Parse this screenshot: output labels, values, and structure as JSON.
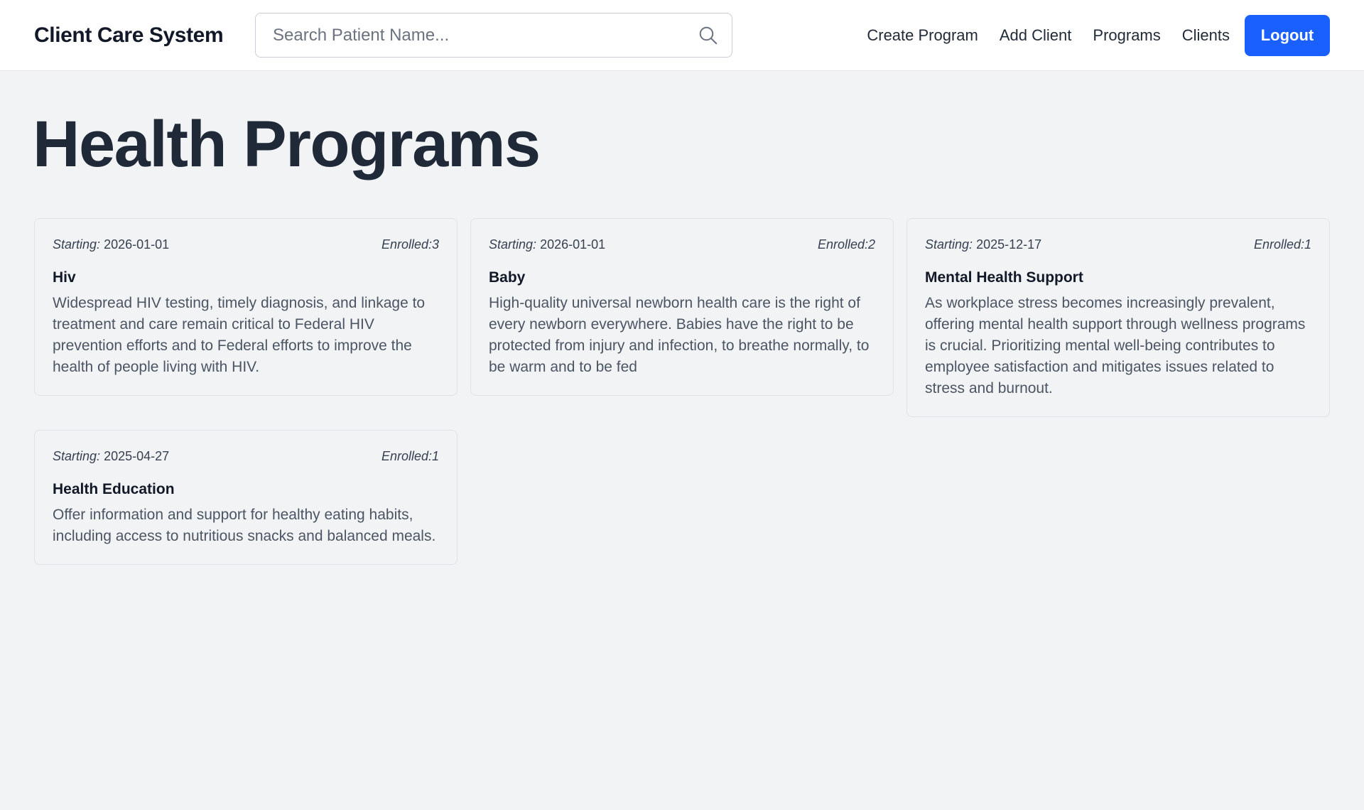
{
  "header": {
    "brand": "Client Care System",
    "search_placeholder": "Search Patient Name...",
    "nav": {
      "create_program": "Create Program",
      "add_client": "Add Client",
      "programs": "Programs",
      "clients": "Clients"
    },
    "logout_label": "Logout"
  },
  "main": {
    "title": "Health Programs",
    "starting_label": "Starting:",
    "programs": [
      {
        "start_date": "2026-01-01",
        "enrolled": "Enrolled:3",
        "name": "Hiv",
        "description": "Widespread HIV testing, timely diagnosis, and linkage to treatment and care remain critical to Federal HIV prevention efforts and to Federal efforts to improve the health of people living with HIV."
      },
      {
        "start_date": "2026-01-01",
        "enrolled": "Enrolled:2",
        "name": "Baby",
        "description": "High-quality universal newborn health care is the right of every newborn everywhere. Babies have the right to be protected from injury and infection, to breathe normally, to be warm and to be fed"
      },
      {
        "start_date": "2025-12-17",
        "enrolled": "Enrolled:1",
        "name": "Mental Health Support",
        "description": "As workplace stress becomes increasingly prevalent, offering mental health support through wellness programs is crucial. Prioritizing mental well-being contributes to employee satisfaction and mitigates issues related to stress and burnout."
      },
      {
        "start_date": "2025-04-27",
        "enrolled": "Enrolled:1",
        "name": "Health Education",
        "description": "Offer information and support for healthy eating habits, including access to nutritious snacks and balanced meals."
      }
    ]
  },
  "colors": {
    "accent": "#1a5fff",
    "page_background": "#f2f3f5",
    "header_background": "#ffffff"
  },
  "icons": {
    "search": "search-icon"
  }
}
